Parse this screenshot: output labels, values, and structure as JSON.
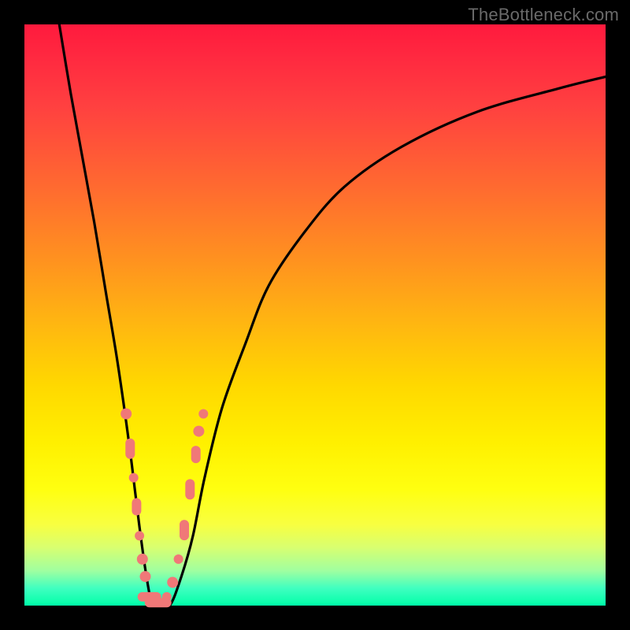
{
  "watermark": "TheBottleneck.com",
  "colors": {
    "frame": "#000000",
    "curve": "#000000",
    "marker_fill": "#f07878",
    "marker_stroke": "#d85a5a"
  },
  "chart_data": {
    "type": "line",
    "title": "",
    "xlabel": "",
    "ylabel": "",
    "xlim": [
      0,
      100
    ],
    "ylim": [
      0,
      100
    ],
    "x": [
      6,
      8,
      10,
      12,
      14,
      16,
      18,
      19,
      20,
      21,
      22,
      23,
      25,
      27,
      29,
      31,
      34,
      38,
      42,
      48,
      55,
      65,
      78,
      92,
      100
    ],
    "values": [
      100,
      88,
      77,
      66,
      54,
      42,
      28,
      20,
      12,
      5,
      0,
      0,
      0,
      5,
      12,
      22,
      34,
      45,
      55,
      64,
      72,
      79,
      85,
      89,
      91
    ],
    "series": [
      {
        "name": "bottleneck-curve",
        "x": [
          6,
          8,
          10,
          12,
          14,
          16,
          18,
          19,
          20,
          21,
          22,
          23,
          25,
          27,
          29,
          31,
          34,
          38,
          42,
          48,
          55,
          65,
          78,
          92,
          100
        ],
        "y": [
          100,
          88,
          77,
          66,
          54,
          42,
          28,
          20,
          12,
          5,
          0,
          0,
          0,
          5,
          12,
          22,
          34,
          45,
          55,
          64,
          72,
          79,
          85,
          89,
          91
        ]
      }
    ],
    "markers": {
      "name": "highlight-points",
      "shape": "circle-and-rounded-rect",
      "color": "#f07878",
      "points": [
        {
          "x": 17.5,
          "y": 33,
          "kind": "circle",
          "r": 7
        },
        {
          "x": 18.2,
          "y": 27,
          "kind": "rect",
          "w": 12,
          "h": 26
        },
        {
          "x": 18.8,
          "y": 22,
          "kind": "circle",
          "r": 6
        },
        {
          "x": 19.3,
          "y": 17,
          "kind": "rect",
          "w": 12,
          "h": 22
        },
        {
          "x": 19.8,
          "y": 12,
          "kind": "circle",
          "r": 6
        },
        {
          "x": 20.3,
          "y": 8,
          "kind": "circle",
          "r": 7
        },
        {
          "x": 20.8,
          "y": 5,
          "kind": "circle",
          "r": 7
        },
        {
          "x": 21.5,
          "y": 1.5,
          "kind": "rect",
          "w": 30,
          "h": 12
        },
        {
          "x": 23.0,
          "y": 0.5,
          "kind": "rect",
          "w": 34,
          "h": 12
        },
        {
          "x": 24.5,
          "y": 1.5,
          "kind": "circle",
          "r": 6
        },
        {
          "x": 25.5,
          "y": 4,
          "kind": "circle",
          "r": 7
        },
        {
          "x": 26.5,
          "y": 8,
          "kind": "circle",
          "r": 6
        },
        {
          "x": 27.5,
          "y": 13,
          "kind": "rect",
          "w": 12,
          "h": 26
        },
        {
          "x": 28.5,
          "y": 20,
          "kind": "rect",
          "w": 12,
          "h": 26
        },
        {
          "x": 29.5,
          "y": 26,
          "kind": "rect",
          "w": 12,
          "h": 22
        },
        {
          "x": 30.0,
          "y": 30,
          "kind": "circle",
          "r": 7
        },
        {
          "x": 30.8,
          "y": 33,
          "kind": "circle",
          "r": 6
        }
      ]
    }
  }
}
